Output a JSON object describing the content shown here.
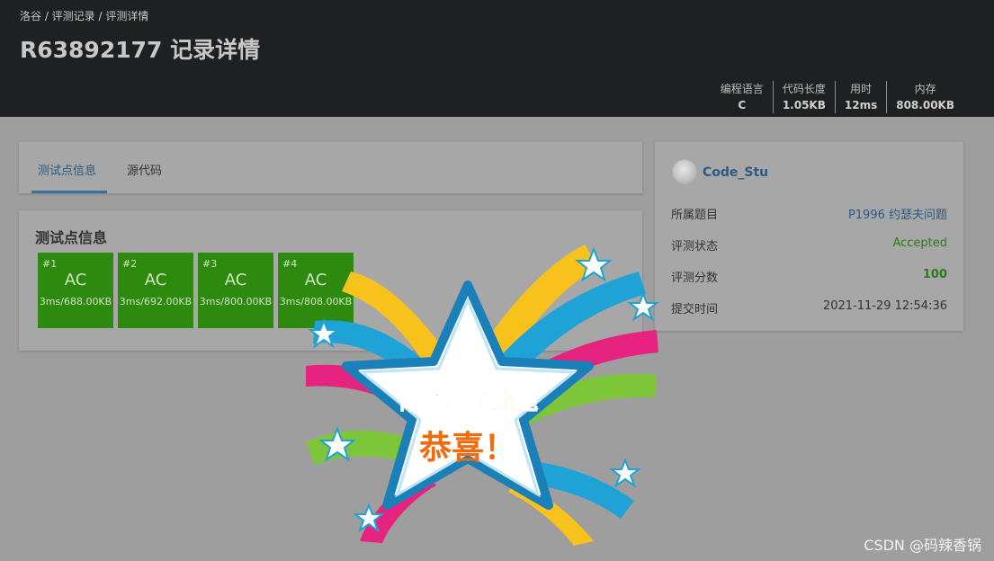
{
  "header": {
    "breadcrumb": "洛谷 / 评测记录 / 评测详情",
    "title": "R63892177 记录详情",
    "stats": [
      {
        "label": "编程语言",
        "value": "C"
      },
      {
        "label": "代码长度",
        "value": "1.05KB"
      },
      {
        "label": "用时",
        "value": "12ms"
      },
      {
        "label": "内存",
        "value": "808.00KB"
      }
    ]
  },
  "tabs": [
    {
      "label": "测试点信息",
      "active": true
    },
    {
      "label": "源代码",
      "active": false
    }
  ],
  "tests": {
    "title": "测试点信息",
    "items": [
      {
        "index": "#1",
        "status": "AC",
        "meta": "3ms/688.00KB"
      },
      {
        "index": "#2",
        "status": "AC",
        "meta": "3ms/692.00KB"
      },
      {
        "index": "#3",
        "status": "AC",
        "meta": "3ms/800.00KB"
      },
      {
        "index": "#4",
        "status": "AC",
        "meta": "3ms/808.00KB"
      }
    ]
  },
  "info": {
    "username": "Code_Stu",
    "rows": [
      {
        "key": "所属题目",
        "value": "P1996 约瑟夫问题"
      },
      {
        "key": "评测状态",
        "value": "Accepted"
      },
      {
        "key": "评测分数",
        "value": "100"
      },
      {
        "key": "提交时间",
        "value": "2021-11-29 12:54:36"
      }
    ]
  },
  "overlay": {
    "line1": "你通过了此题",
    "line2": "恭喜！"
  },
  "watermark": "CSDN @码辣香锅",
  "colors": {
    "header_bg": "#1f2021",
    "accepted": "#2d8a0e",
    "link": "#2a5a85",
    "star_text_blue": "#f5b60f",
    "star_text_orange": "#f36b0f"
  }
}
